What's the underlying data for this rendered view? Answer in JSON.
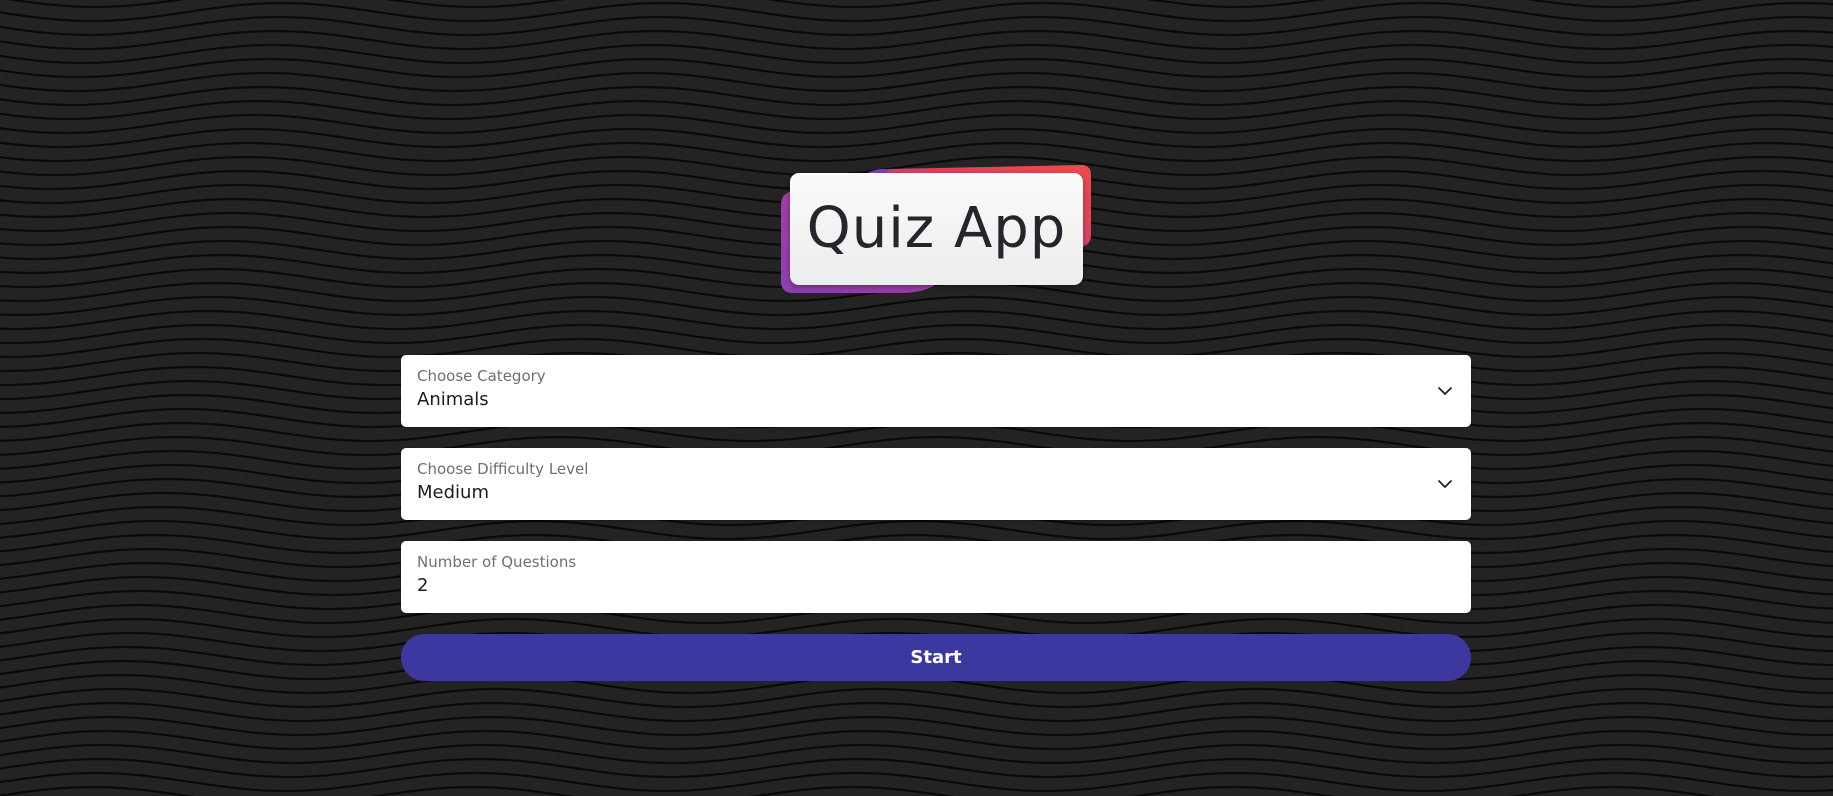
{
  "app": {
    "title": "Quiz App"
  },
  "form": {
    "category": {
      "label": "Choose Category",
      "value": "Animals",
      "icon": "chevron-down-icon"
    },
    "difficulty": {
      "label": "Choose Difficulty Level",
      "value": "Medium",
      "icon": "chevron-down-icon"
    },
    "questions": {
      "label": "Number of Questions",
      "value": "2"
    },
    "start_label": "Start"
  },
  "colors": {
    "background": "#232323",
    "wave_line": "#0a0a0a",
    "accent": "#3c38a0",
    "logo_blob_purple": "#8a3cb4",
    "logo_blob_red": "#e0455a",
    "card": "#ffffff"
  }
}
